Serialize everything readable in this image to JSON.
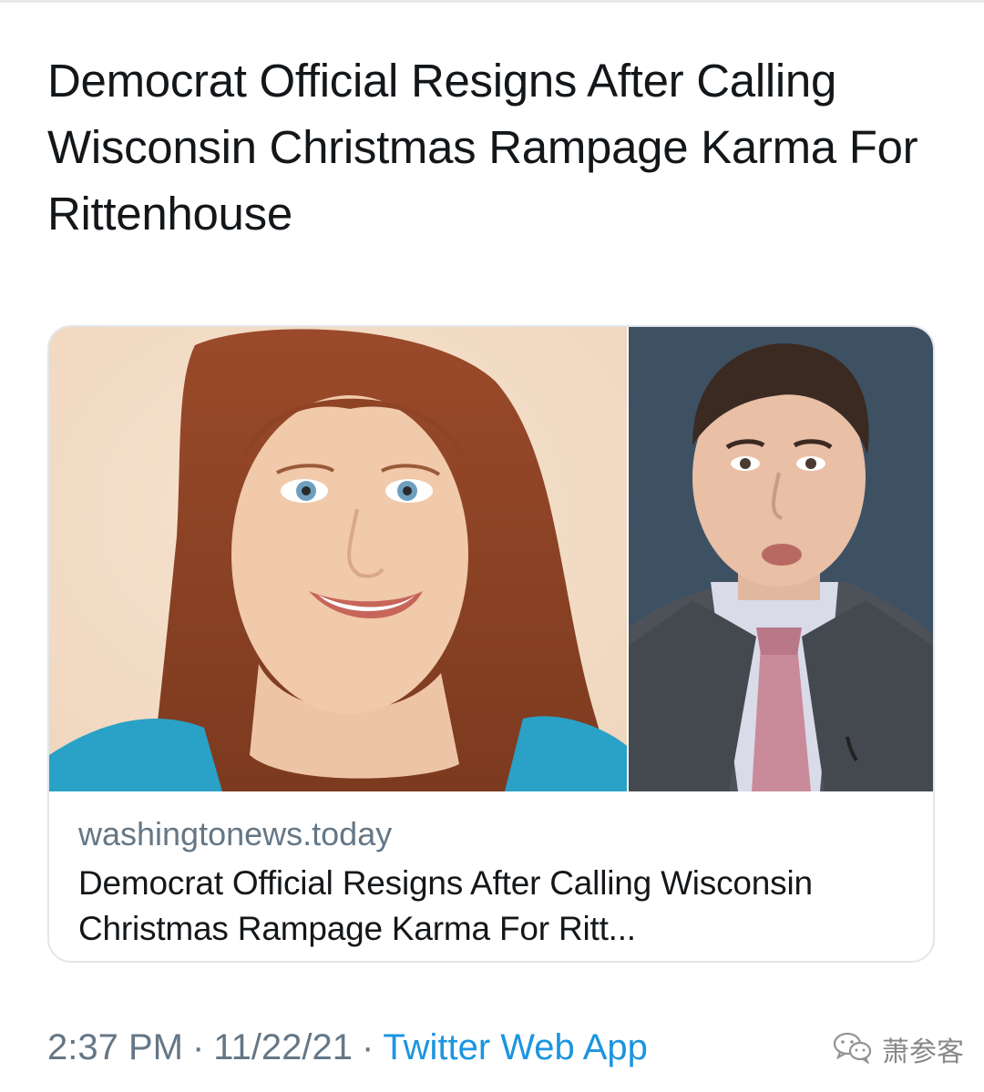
{
  "tweet": {
    "text": "Democrat Official Resigns After Calling Wisconsin Christmas Rampage Karma For Rittenhouse"
  },
  "card": {
    "domain": "washingtonews.today",
    "title": "Democrat Official Resigns After Calling Wisconsin Christmas Rampage Karma For Ritt..."
  },
  "footer": {
    "time": "2:37 PM",
    "separator": "·",
    "date": "11/22/21",
    "source": "Twitter Web App"
  },
  "watermark": {
    "text": "萧参客",
    "icon": "wechat-icon"
  },
  "colors": {
    "text_primary": "#14171a",
    "text_secondary": "#657786",
    "link": "#1b95e0",
    "card_border": "#e2e6ea"
  }
}
